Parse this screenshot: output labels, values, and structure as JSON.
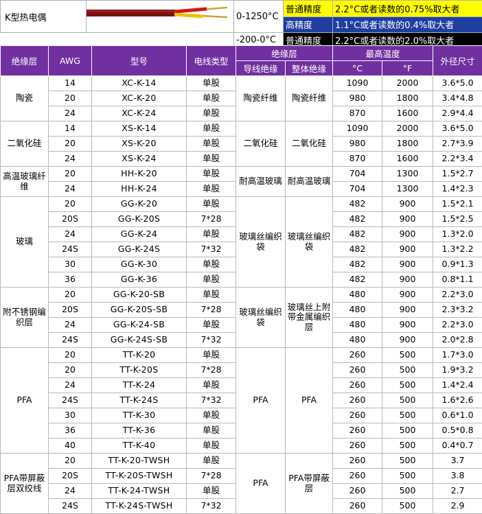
{
  "header": {
    "title": "K型热电偶",
    "range_high": "0-1250°C",
    "range_low": "-200-0°C",
    "grades": [
      {
        "label": "普通精度",
        "text": "2.2°C或者读数的0.75%取大者",
        "color": "#ffff00"
      },
      {
        "label": "高精度",
        "text": "1.1°C或者读数的0.4%取大者",
        "color": "#1f3ea0"
      },
      {
        "label": "普通精度",
        "text": "2.2°C或者读数的2.0%取大者",
        "color": "#000000"
      }
    ]
  },
  "columns": {
    "insulation": "绝缘层",
    "awg": "AWG",
    "model": "型号",
    "wire_type": "电线类型",
    "insulation_group": "绝缘层",
    "conductor_ins": "导线绝缘",
    "overall_ins": "整体绝缘",
    "max_temp": "最高温度",
    "c": "°C",
    "f": "°F",
    "od": "外径尺寸"
  },
  "groups": [
    {
      "name": "陶瓷",
      "cond": "陶瓷纤维",
      "overall": "陶瓷纤维",
      "rows": [
        {
          "awg": "14",
          "model": "XC-K-14",
          "type": "单股",
          "c": "1090",
          "f": "2000",
          "od": "3.6*5.0"
        },
        {
          "awg": "20",
          "model": "XC-K-20",
          "type": "单股",
          "c": "980",
          "f": "1800",
          "od": "3.4*4.8"
        },
        {
          "awg": "24",
          "model": "XC-K-24",
          "type": "单股",
          "c": "870",
          "f": "1600",
          "od": "2.9*4.4"
        }
      ]
    },
    {
      "name": "二氧化硅",
      "cond": "二氧化硅",
      "overall": "二氧化硅",
      "rows": [
        {
          "awg": "14",
          "model": "XS-K-14",
          "type": "单股",
          "c": "1090",
          "f": "2000",
          "od": "3.6*5.0"
        },
        {
          "awg": "20",
          "model": "XS-K-20",
          "type": "单股",
          "c": "980",
          "f": "1800",
          "od": "2.7*3.9"
        },
        {
          "awg": "24",
          "model": "XS-K-24",
          "type": "单股",
          "c": "870",
          "f": "1600",
          "od": "2.2*3.4"
        }
      ]
    },
    {
      "name": "高温玻璃纤维",
      "cond": "耐高温玻璃",
      "overall": "耐高温玻璃",
      "rows": [
        {
          "awg": "20",
          "model": "HH-K-20",
          "type": "单股",
          "c": "704",
          "f": "1300",
          "od": "1.5*2.7"
        },
        {
          "awg": "24",
          "model": "HH-K-24",
          "type": "单股",
          "c": "704",
          "f": "1300",
          "od": "1.4*2.3"
        }
      ]
    },
    {
      "name": "玻璃",
      "cond": "玻璃丝编织袋",
      "overall": "玻璃丝编织袋",
      "rows": [
        {
          "awg": "20",
          "model": "GG-K-20",
          "type": "单股",
          "c": "482",
          "f": "900",
          "od": "1.5*2.1"
        },
        {
          "awg": "20S",
          "model": "GG-K-20S",
          "type": "7*28",
          "c": "482",
          "f": "900",
          "od": "1.5*2.5"
        },
        {
          "awg": "24",
          "model": "GG-K-24",
          "type": "单股",
          "c": "482",
          "f": "900",
          "od": "1.3*2.0"
        },
        {
          "awg": "24S",
          "model": "GG-K-24S",
          "type": "7*32",
          "c": "482",
          "f": "900",
          "od": "1.3*2.2"
        },
        {
          "awg": "30",
          "model": "GG-K-30",
          "type": "单股",
          "c": "482",
          "f": "900",
          "od": "0.9*1.3"
        },
        {
          "awg": "36",
          "model": "GG-K-36",
          "type": "单股",
          "c": "482",
          "f": "900",
          "od": "0.8*1.1"
        }
      ]
    },
    {
      "name": "附不锈钢编织层",
      "cond": "玻璃丝编织袋",
      "overall": "玻璃丝上附带金属编织层",
      "rows": [
        {
          "awg": "20",
          "model": "GG-K-20-SB",
          "type": "单股",
          "c": "480",
          "f": "900",
          "od": "2.2*3.0"
        },
        {
          "awg": "20S",
          "model": "GG-K-20S-SB",
          "type": "7*28",
          "c": "480",
          "f": "900",
          "od": "2.3*3.2"
        },
        {
          "awg": "24",
          "model": "GG-K-24-SB",
          "type": "单股",
          "c": "480",
          "f": "900",
          "od": "2.2*3.0"
        },
        {
          "awg": "24S",
          "model": "GG-K-24S-SB",
          "type": "7*32",
          "c": "480",
          "f": "900",
          "od": "2.0*2.8"
        }
      ]
    },
    {
      "name": "PFA",
      "cond": "PFA",
      "overall": "PFA",
      "rows": [
        {
          "awg": "20",
          "model": "TT-K-20",
          "type": "单股",
          "c": "260",
          "f": "500",
          "od": "1.7*3.0"
        },
        {
          "awg": "20",
          "model": "TT-K-20S",
          "type": "7*28",
          "c": "260",
          "f": "500",
          "od": "1.9*3.2"
        },
        {
          "awg": "24",
          "model": "TT-K-24",
          "type": "单股",
          "c": "260",
          "f": "500",
          "od": "1.4*2.4"
        },
        {
          "awg": "24S",
          "model": "TT-K-24S",
          "type": "7*32",
          "c": "260",
          "f": "500",
          "od": "1.6*2.6"
        },
        {
          "awg": "30",
          "model": "TT-K-30",
          "type": "单股",
          "c": "260",
          "f": "500",
          "od": "0.6*1.0"
        },
        {
          "awg": "36",
          "model": "TT-K-36",
          "type": "单股",
          "c": "260",
          "f": "500",
          "od": "0.5*0.8"
        },
        {
          "awg": "40",
          "model": "TT-K-40",
          "type": "单股",
          "c": "260",
          "f": "500",
          "od": "0.4*0.7"
        }
      ]
    },
    {
      "name": "PFA带屏蔽层双绞线",
      "cond": "PFA",
      "overall": "PFA带屏蔽层",
      "rows": [
        {
          "awg": "20",
          "model": "TT-K-20-TWSH",
          "type": "单股",
          "c": "260",
          "f": "500",
          "od": "3.7"
        },
        {
          "awg": "20S",
          "model": "TT-K-20S-TWSH",
          "type": "7*28",
          "c": "260",
          "f": "500",
          "od": "3.8"
        },
        {
          "awg": "24",
          "model": "TT-K-24-TWSH",
          "type": "单股",
          "c": "260",
          "f": "500",
          "od": "2.7"
        },
        {
          "awg": "24S",
          "model": "TT-K-24S-TWSH",
          "type": "7*32",
          "c": "260",
          "f": "500",
          "od": "2.9"
        }
      ]
    }
  ]
}
